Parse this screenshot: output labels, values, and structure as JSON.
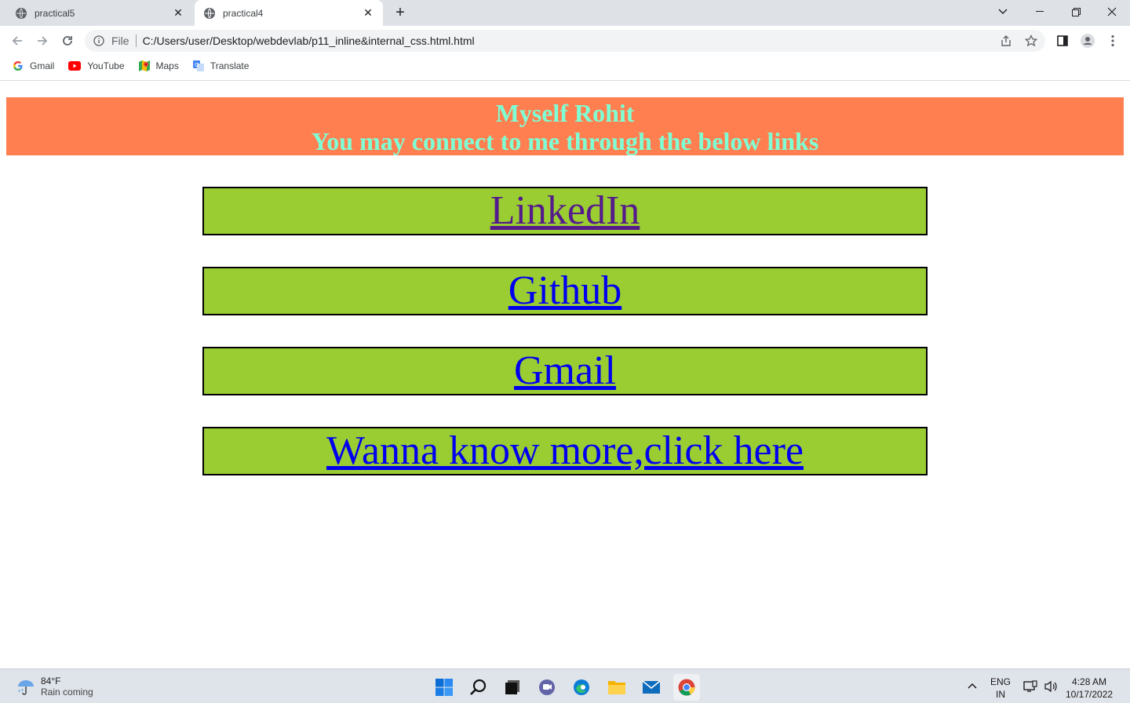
{
  "browser": {
    "tabs": [
      {
        "title": "practical5",
        "active": false
      },
      {
        "title": "practical4",
        "active": true
      }
    ],
    "omnibox": {
      "scheme_label": "File",
      "url": "C:/Users/user/Desktop/webdevlab/p11_inline&internal_css.html.html"
    },
    "bookmarks": [
      {
        "label": "Gmail",
        "icon": "google-icon"
      },
      {
        "label": "YouTube",
        "icon": "youtube-icon"
      },
      {
        "label": "Maps",
        "icon": "maps-icon"
      },
      {
        "label": "Translate",
        "icon": "translate-icon"
      }
    ]
  },
  "page": {
    "banner": {
      "line1": "Myself Rohit",
      "line2": "You may connect to me through the below links",
      "background": "#ff7f50",
      "text_color": "#7fffd4"
    },
    "links": [
      {
        "label": "LinkedIn",
        "visited": true
      },
      {
        "label": "Github",
        "visited": false
      },
      {
        "label": "Gmail",
        "visited": false
      },
      {
        "label": "Wanna know more,click here",
        "visited": false
      }
    ],
    "link_box_color": "#9acd32"
  },
  "taskbar": {
    "weather": {
      "temp": "84°F",
      "condition": "Rain coming"
    },
    "apps": [
      "windows-start-icon",
      "search-icon",
      "task-view-icon",
      "teams-chat-icon",
      "edge-icon",
      "file-explorer-icon",
      "mail-icon",
      "chrome-icon"
    ],
    "language": {
      "line1": "ENG",
      "line2": "IN"
    },
    "clock": {
      "time": "4:28 AM",
      "date": "10/17/2022"
    }
  }
}
